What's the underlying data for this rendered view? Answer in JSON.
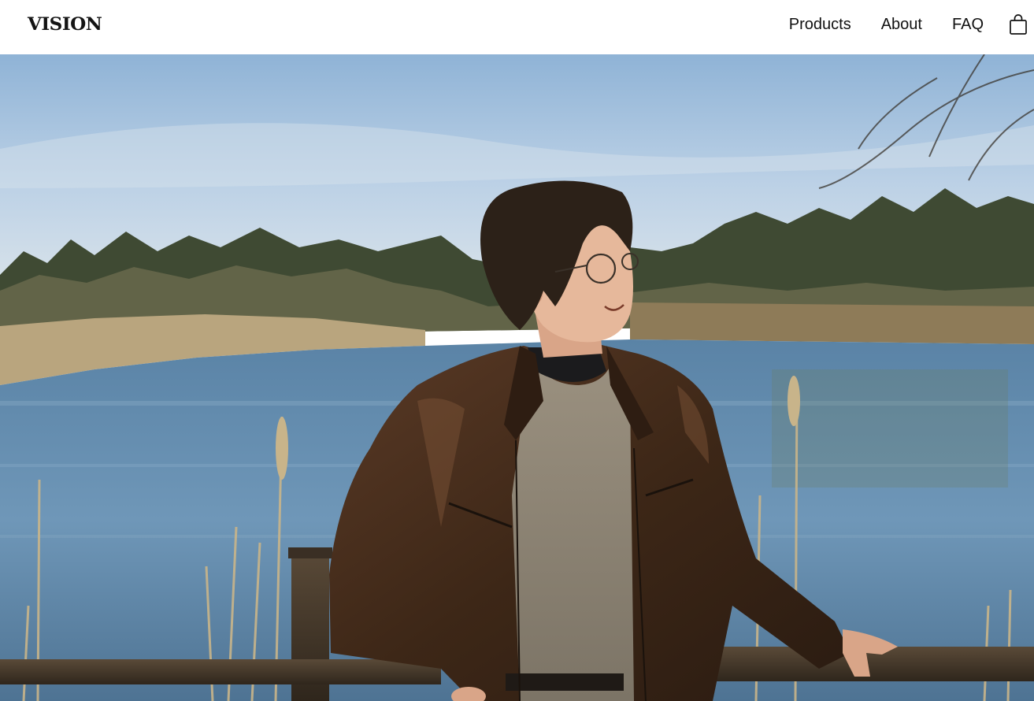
{
  "header": {
    "logo": "VISION",
    "nav": [
      {
        "label": "Products"
      },
      {
        "label": "About"
      },
      {
        "label": "FAQ"
      }
    ],
    "cart_icon": "shopping-bag-icon"
  },
  "hero": {
    "image": "man-in-leather-jacket-by-lake-photo"
  }
}
